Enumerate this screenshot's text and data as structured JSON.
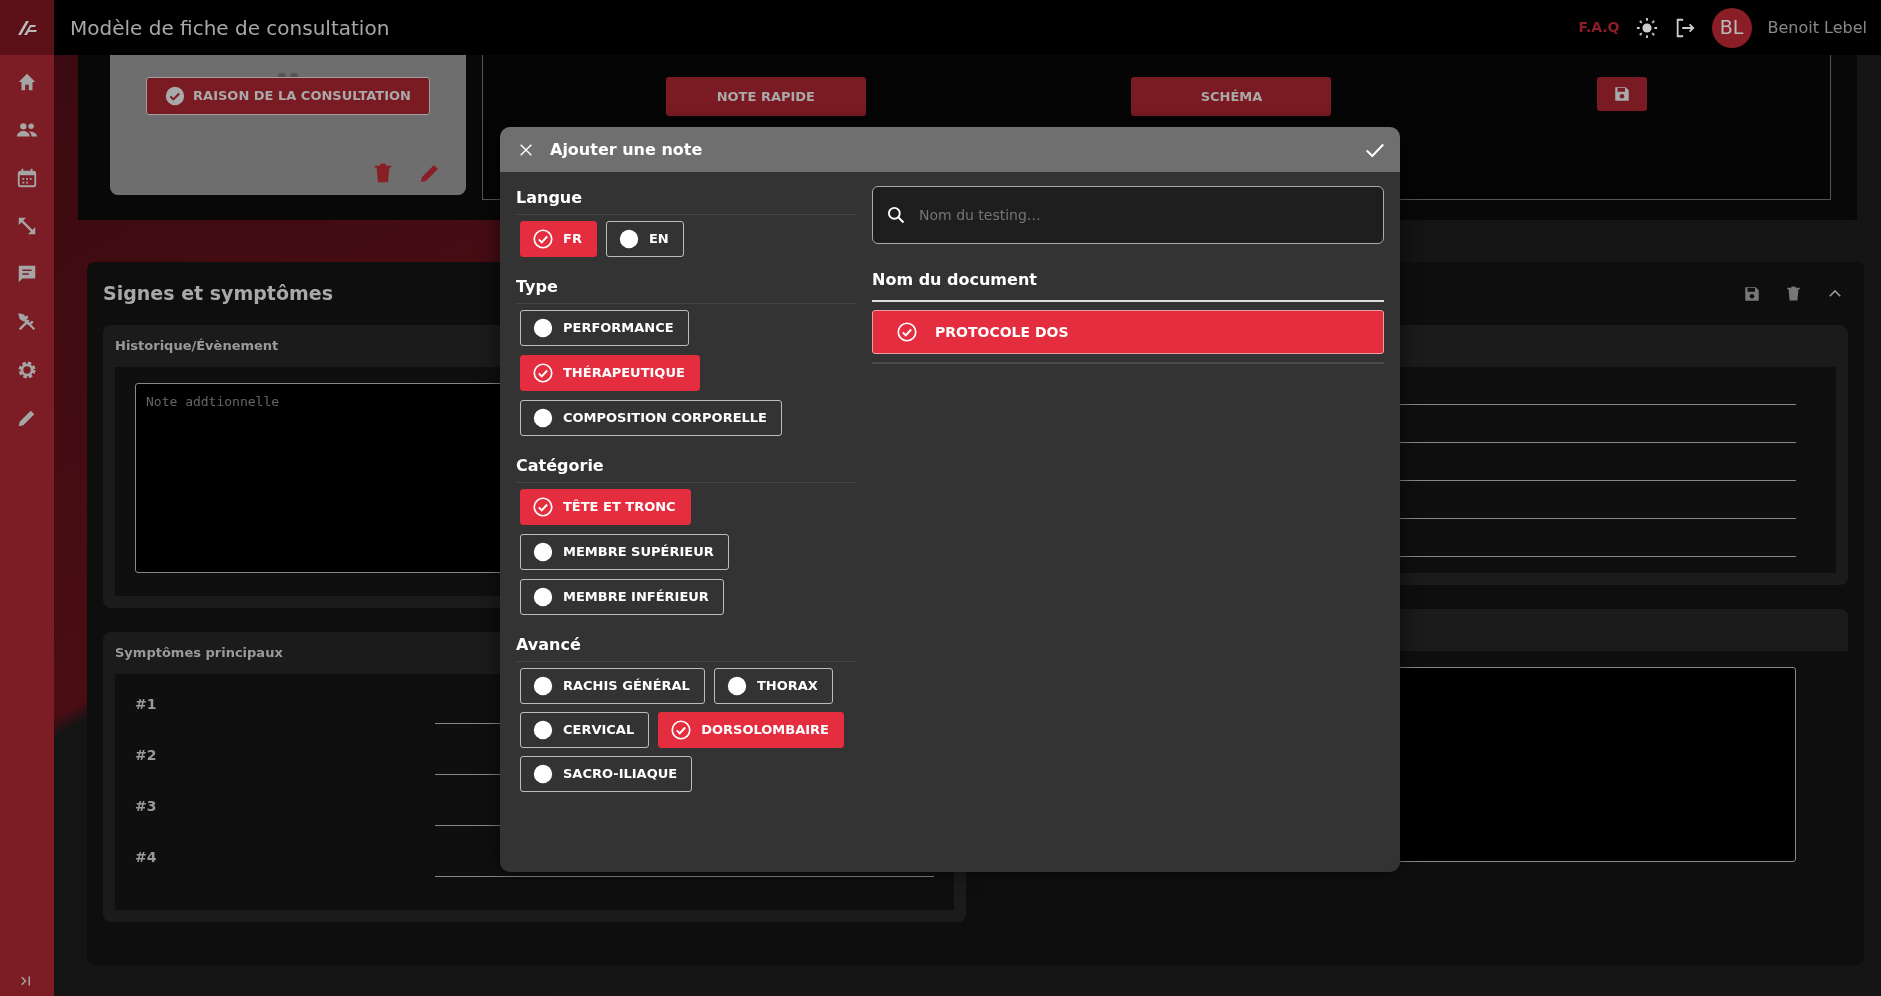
{
  "topbar": {
    "title": "Modèle de fiche de consultation",
    "faq": "F.A.Q",
    "user": {
      "initials": "BL",
      "name": "Benoit Lebel"
    }
  },
  "consultation": {
    "reason_button": "RAISON DE LA CONSULTATION",
    "buttons": [
      "NOTE RAPIDE",
      "SCHÉMA"
    ]
  },
  "signs_panel": {
    "title": "Signes et symptômes",
    "history": {
      "title": "Historique/Évènement",
      "placeholder": "Note addtionnelle"
    },
    "symptoms": {
      "title": "Symptômes principaux",
      "rows": [
        "#1",
        "#2",
        "#3",
        "#4"
      ]
    }
  },
  "modal": {
    "title": "Ajouter une note",
    "sections": [
      {
        "title": "Langue",
        "kind": "wrap",
        "options": [
          {
            "label": "FR",
            "selected": true
          },
          {
            "label": "EN",
            "selected": false
          }
        ]
      },
      {
        "title": "Type",
        "kind": "stack",
        "options": [
          {
            "label": "PERFORMANCE",
            "selected": false
          },
          {
            "label": "THÉRAPEUTIQUE",
            "selected": true
          },
          {
            "label": "COMPOSITION CORPORELLE",
            "selected": false
          }
        ]
      },
      {
        "title": "Catégorie",
        "kind": "stack",
        "options": [
          {
            "label": "TÊTE ET TRONC",
            "selected": true
          },
          {
            "label": "MEMBRE SUPÉRIEUR",
            "selected": false
          },
          {
            "label": "MEMBRE INFÉRIEUR",
            "selected": false
          }
        ]
      },
      {
        "title": "Avancé",
        "kind": "wrap",
        "options": [
          {
            "label": "RACHIS GÉNÉRAL",
            "selected": false
          },
          {
            "label": "THORAX",
            "selected": false
          },
          {
            "label": "CERVICAL",
            "selected": false
          },
          {
            "label": "DORSOLOMBAIRE",
            "selected": true
          },
          {
            "label": "SACRO-ILIAQUE",
            "selected": false
          }
        ]
      }
    ],
    "search": {
      "placeholder": "Nom du testing…"
    },
    "documents": {
      "title": "Nom du document",
      "items": [
        {
          "label": "PROTOCOLE DOS",
          "selected": true
        }
      ]
    }
  }
}
